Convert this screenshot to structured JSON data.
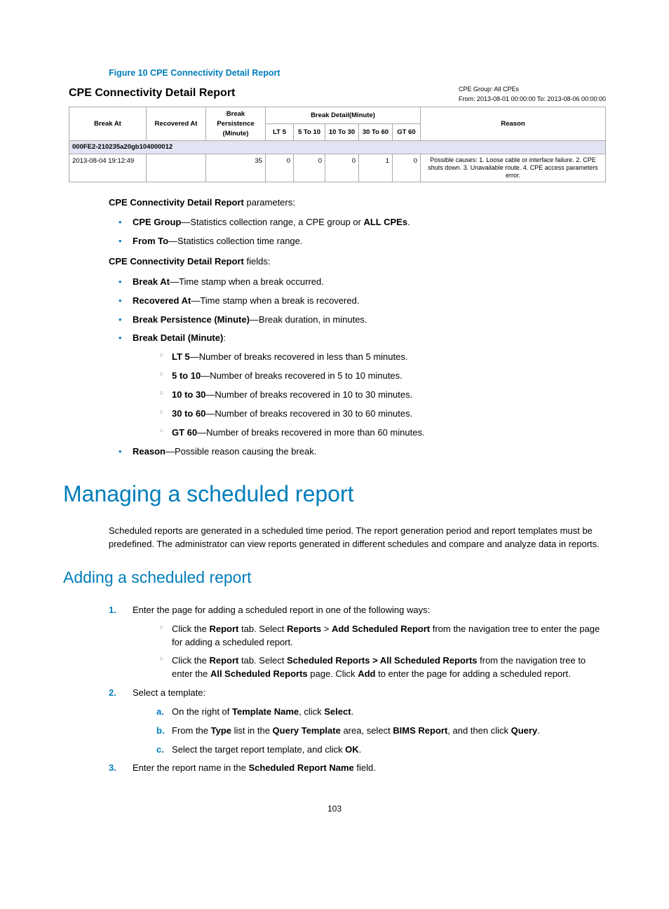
{
  "figure": {
    "caption": "Figure 10 CPE Connectivity Detail Report",
    "title": "CPE Connectivity Detail Report",
    "meta_group": "CPE Group:  All CPEs",
    "meta_range": "From:  2013-08-01 00:00:00   To:   2013-08-06 00:00:00",
    "headers": {
      "break_at": "Break At",
      "recovered_at": "Recovered At",
      "persistence": "Break Persistence (Minute)",
      "detail_group": "Break Detail(Minute)",
      "lt5": "LT 5",
      "r5_10": "5 To 10",
      "r10_30": "10 To 30",
      "r30_60": "30 To 60",
      "gt60": "GT 60",
      "reason": "Reason"
    },
    "group_row": "000FE2-210235a20gb104000012",
    "row": {
      "break_at": "2013-08-04 19:12:49",
      "recovered_at": "",
      "persistence": "35",
      "lt5": "0",
      "r5_10": "0",
      "r10_30": "0",
      "r30_60": "1",
      "gt60": "0",
      "reason": "Possible causes: 1. Loose cable or interface failure. 2. CPE shuts down. 3. Unavailable route. 4. CPE access parameters error."
    }
  },
  "params": {
    "intro_bold": "CPE Connectivity Detail Report",
    "intro_rest": " parameters:",
    "cpe_group_b": "CPE Group",
    "cpe_group_t": "—Statistics collection range, a CPE group or ",
    "cpe_group_b2": "ALL CPEs",
    "cpe_group_t2": ".",
    "from_to_b": "From To",
    "from_to_t": "—Statistics collection time range."
  },
  "fields": {
    "intro_bold": "CPE Connectivity Detail Report",
    "intro_rest": " fields:",
    "break_at_b": "Break At",
    "break_at_t": "—Time stamp when a break occurred.",
    "recovered_b": "Recovered At",
    "recovered_t": "—Time stamp when a break is recovered.",
    "persist_b": "Break Persistence (Minute)",
    "persist_t": "—Break duration, in minutes.",
    "detail_b": "Break Detail (Minute)",
    "detail_t": ":",
    "lt5_b": "LT 5",
    "lt5_t": "—Number of breaks recovered in less than 5 minutes.",
    "r5_10_b": "5 to 10",
    "r5_10_t": "—Number of breaks recovered in 5 to 10 minutes.",
    "r10_30_b": "10 to 30",
    "r10_30_t": "—Number of breaks recovered in 10 to 30 minutes.",
    "r30_60_b": "30 to 60",
    "r30_60_t": "—Number of breaks recovered in 30 to 60 minutes.",
    "gt60_b": "GT 60",
    "gt60_t": "—Number of breaks recovered in more than 60 minutes.",
    "reason_b": "Reason",
    "reason_t": "—Possible reason causing the break."
  },
  "h1": "Managing a scheduled report",
  "mgmt_para": "Scheduled reports are generated in a scheduled time period. The report generation period and report templates must be predefined. The administrator can view reports generated in different schedules and compare and analyze data in reports.",
  "h2": "Adding a scheduled report",
  "steps": {
    "s1": "Enter the page for adding a scheduled report in one of the following ways:",
    "s1a_1": "Click the ",
    "s1a_b1": "Report",
    "s1a_2": " tab. Select ",
    "s1a_b2": "Reports",
    "s1a_3": " > ",
    "s1a_b3": "Add Scheduled Report",
    "s1a_4": " from the navigation tree to enter the page for adding a scheduled report.",
    "s1b_1": "Click the ",
    "s1b_b1": "Report",
    "s1b_2": " tab. Select ",
    "s1b_b2": "Scheduled Reports > All Scheduled Reports",
    "s1b_3": " from the navigation tree to enter the ",
    "s1b_b3": "All Scheduled Reports",
    "s1b_4": " page. Click ",
    "s1b_b4": "Add",
    "s1b_5": " to enter the page for adding a scheduled report.",
    "s2": "Select a template:",
    "s2a_1": "On the right of ",
    "s2a_b1": "Template Name",
    "s2a_2": ", click ",
    "s2a_b2": "Select",
    "s2a_3": ".",
    "s2b_1": "From the ",
    "s2b_b1": "Type",
    "s2b_2": " list in the ",
    "s2b_b2": "Query Template",
    "s2b_3": " area, select ",
    "s2b_b3": "BIMS Report",
    "s2b_4": ", and then click ",
    "s2b_b4": "Query",
    "s2b_5": ".",
    "s2c_1": "Select the target report template, and click ",
    "s2c_b1": "OK",
    "s2c_2": ".",
    "s3_1": "Enter the report name in the ",
    "s3_b1": "Scheduled Report Name",
    "s3_2": " field."
  },
  "page_number": "103"
}
